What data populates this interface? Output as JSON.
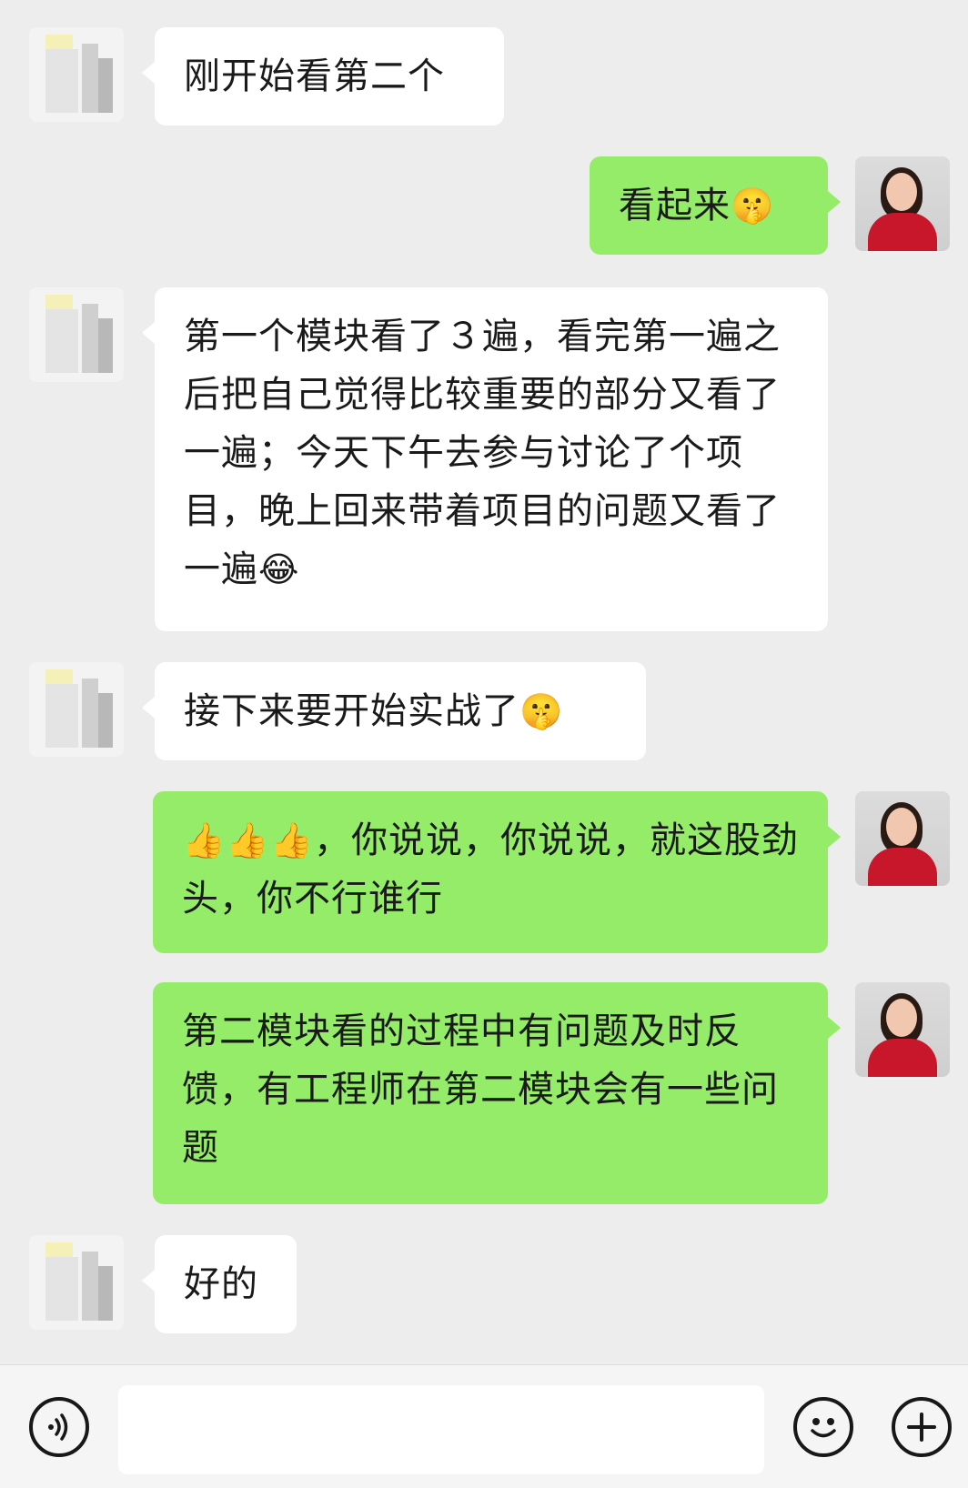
{
  "messages": [
    {
      "sender": "other",
      "text": "刚开始看第二个",
      "emoji": ""
    },
    {
      "sender": "me",
      "text": "看起来",
      "emoji": "🤫"
    },
    {
      "sender": "other",
      "text": "第一个模块看了３遍，看完第一遍之后把自己觉得比较重要的部分又看了一遍；今天下午去参与讨论了个项目，晚上回来带着项目的问题又看了一遍",
      "emoji": "😂"
    },
    {
      "sender": "other",
      "text": "接下来要开始实战了",
      "emoji": "🤫"
    },
    {
      "sender": "me",
      "text": "，你说说，你说说，就这股劲头，你不行谁行",
      "emoji": "👍👍👍"
    },
    {
      "sender": "me",
      "text": "第二模块看的过程中有问题及时反馈，有工程师在第二模块会有一些问题",
      "emoji": ""
    },
    {
      "sender": "other",
      "text": "好的",
      "emoji": ""
    }
  ],
  "input_bar": {
    "voice_icon": "voice-icon",
    "emoji_icon": "emoji-icon",
    "plus_icon": "plus-icon"
  },
  "colors": {
    "background": "#ededed",
    "bubble_me": "#95ec69",
    "bubble_other": "#ffffff"
  }
}
